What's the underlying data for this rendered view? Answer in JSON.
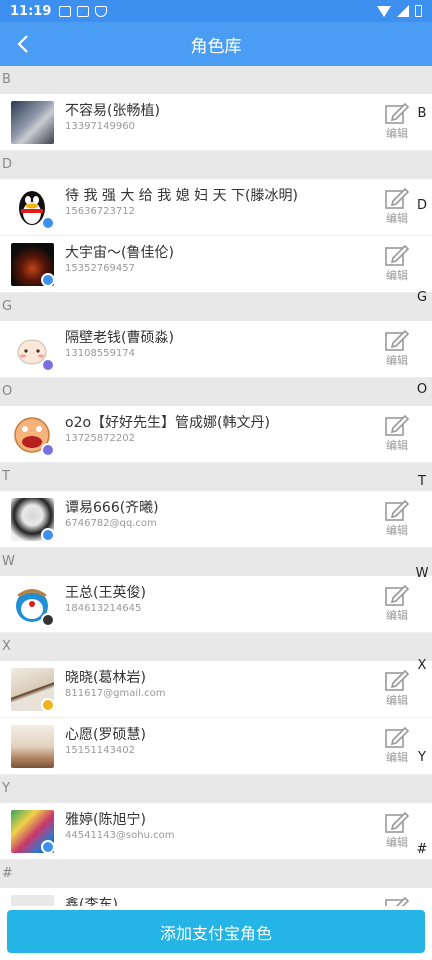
{
  "status": {
    "time": "11:19"
  },
  "header": {
    "title": "角色库"
  },
  "sections": [
    {
      "letter": "B",
      "items": [
        {
          "name": "不容易(张畅植)",
          "account": "13397149960"
        }
      ]
    },
    {
      "letter": "D",
      "items": [
        {
          "name": "待 我 强 大 给 我 媳 妇 天 下(滕冰明)",
          "account": "15636723712"
        },
        {
          "name": "大宇宙～(鲁佳伦)",
          "account": "15352769457"
        }
      ]
    },
    {
      "letter": "G",
      "items": [
        {
          "name": "隔壁老钱(曹硕淼)",
          "account": "13108559174"
        }
      ]
    },
    {
      "letter": "O",
      "items": [
        {
          "name": "o2o【好好先生】管成娜(韩文丹)",
          "account": "13725872202"
        }
      ]
    },
    {
      "letter": "T",
      "items": [
        {
          "name": "谭易666(齐曦)",
          "account": "6746782@qq.com"
        }
      ]
    },
    {
      "letter": "W",
      "items": [
        {
          "name": "王总(王英俊)",
          "account": "184613214645"
        }
      ]
    },
    {
      "letter": "X",
      "items": [
        {
          "name": "晓晓(葛林岩)",
          "account": "811617@gmail.com"
        },
        {
          "name": "心愿(罗硕慧)",
          "account": "15151143402"
        }
      ]
    },
    {
      "letter": "Y",
      "items": [
        {
          "name": "雅婷(陈旭宁)",
          "account": "44541143@sohu.com"
        }
      ]
    },
    {
      "letter": "#",
      "items": [
        {
          "name": "鑫(李东)",
          "account": ""
        }
      ]
    }
  ],
  "edit_label": "编辑",
  "index_letters": [
    "B",
    "D",
    "G",
    "O",
    "T",
    "W",
    "X",
    "Y",
    "#"
  ],
  "add_button": "添加支付宝角色",
  "colors": {
    "header": "#4a9df2",
    "button": "#24b4e6"
  }
}
